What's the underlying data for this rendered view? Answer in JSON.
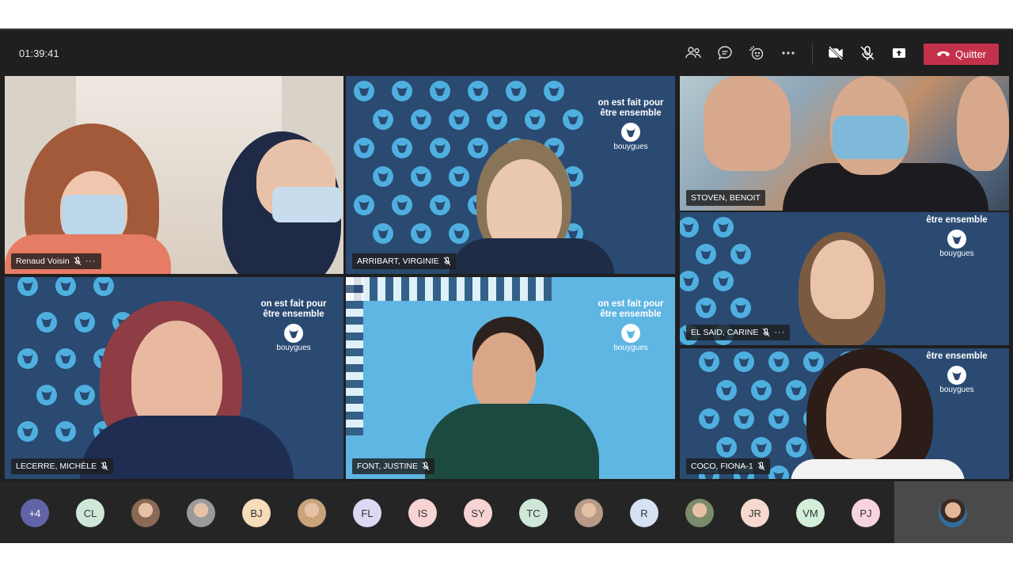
{
  "timer": "01:39:41",
  "toolbar": {
    "icons": [
      "people-icon",
      "chat-icon",
      "reactions-icon",
      "more-icon",
      "camera-off-icon",
      "mic-off-icon",
      "share-icon"
    ],
    "quit_label": "Quitter",
    "quit_color": "#c4314b"
  },
  "brand": {
    "tagline_1": "on est fait pour",
    "tagline_2": "être ensemble",
    "wordmark": "bouygues"
  },
  "tiles": [
    {
      "id": "t1",
      "name": "Renaud Voisin",
      "more": "···"
    },
    {
      "id": "t2",
      "name": "ARRIBART, VIRGINIE"
    },
    {
      "id": "t3",
      "name": "STOVEN, BENOIT"
    },
    {
      "id": "t4",
      "name": "EL SAID, CARINE",
      "more": "···"
    },
    {
      "id": "t5",
      "name": "LECERRE, MICHÈLE"
    },
    {
      "id": "t6",
      "name": "FONT, JUSTINE"
    },
    {
      "id": "t7",
      "name": "COCO, FIONA-1"
    }
  ],
  "participants": [
    {
      "label": "+4",
      "bg": "#6264a7",
      "fg": "#ffffff"
    },
    {
      "label": "CL",
      "bg": "#cfe7d9"
    },
    {
      "label": "",
      "bg": "#8a6a55",
      "photo": true
    },
    {
      "label": "",
      "bg": "#9a9a9a",
      "photo": true
    },
    {
      "label": "BJ",
      "bg": "#f6dcb8"
    },
    {
      "label": "",
      "bg": "#c9a37a",
      "photo": true
    },
    {
      "label": "FL",
      "bg": "#dcd8f3"
    },
    {
      "label": "IS",
      "bg": "#f7d3d3"
    },
    {
      "label": "SY",
      "bg": "#f7d3d3"
    },
    {
      "label": "TC",
      "bg": "#cfe7d9"
    },
    {
      "label": "",
      "bg": "#b89a86",
      "photo": true
    },
    {
      "label": "R",
      "bg": "#d6e2f3"
    },
    {
      "label": "",
      "bg": "#7a8a6a",
      "photo": true
    },
    {
      "label": "JR",
      "bg": "#f7d9cf"
    },
    {
      "label": "VM",
      "bg": "#d3efd9"
    },
    {
      "label": "PJ",
      "bg": "#f7d3df"
    }
  ]
}
